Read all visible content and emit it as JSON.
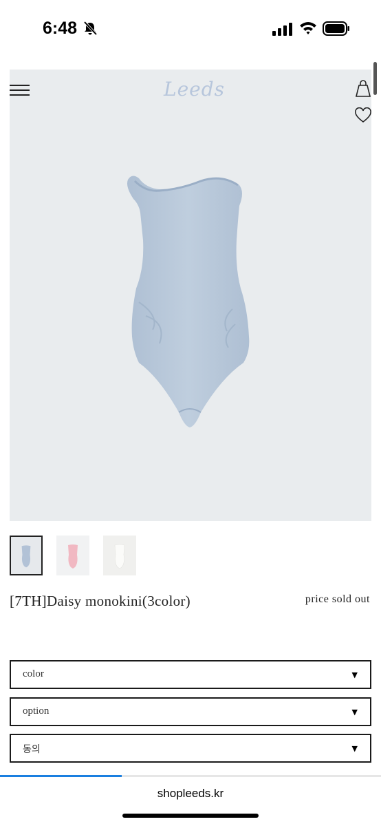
{
  "status_bar": {
    "time": "6:48",
    "bell_icon": "bell-slash-icon",
    "signal_icon": "cellular-signal-icon",
    "wifi_icon": "wifi-icon",
    "battery_icon": "battery-icon"
  },
  "header": {
    "menu_icon": "hamburger-menu-icon",
    "logo": "Leeds",
    "bag_icon": "shopping-bag-icon",
    "wishlist_icon": "heart-icon"
  },
  "product": {
    "name": "[7TH]Daisy monokini(3color)",
    "price": "price sold out",
    "thumbnails": [
      {
        "color": "#b9c8da",
        "selected": true
      },
      {
        "color": "#f1b8c2",
        "selected": false
      },
      {
        "color": "#f4f4f1",
        "selected": false
      }
    ]
  },
  "selects": {
    "color": {
      "label": "color",
      "arrow": "▼"
    },
    "option": {
      "label": "option",
      "arrow": "▼"
    },
    "agree": {
      "label": "동의",
      "arrow": "▼"
    }
  },
  "browser": {
    "url": "shopleeds.kr",
    "load_progress": 0.32
  },
  "colors": {
    "accent": "#1a7fe0",
    "hero_bg": "#e9ecee",
    "swimsuit": "#b9c8da"
  }
}
